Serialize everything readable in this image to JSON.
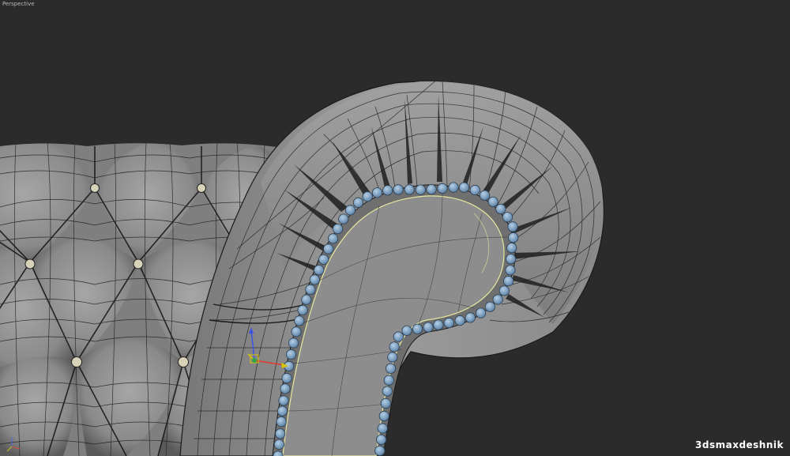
{
  "viewport": {
    "label": "Perspective",
    "background": "#2b2b2b"
  },
  "scene": {
    "objects": [
      "tufted-sofa-back",
      "rolled-armrest",
      "nailhead-trim-row",
      "transform-gizmo"
    ],
    "mesh_color": "#8c8c8c",
    "wire_color": "#1e1e1e",
    "stud_color": "#7fa6c9",
    "selection_edge_color": "#e8e8a0"
  },
  "gizmo": {
    "axes": [
      "x",
      "y",
      "z"
    ],
    "colors": {
      "x": "#e53a2a",
      "y": "#d8c400",
      "z": "#3a55e8"
    }
  },
  "watermark": {
    "text": "3dsmaxdeshnik"
  }
}
